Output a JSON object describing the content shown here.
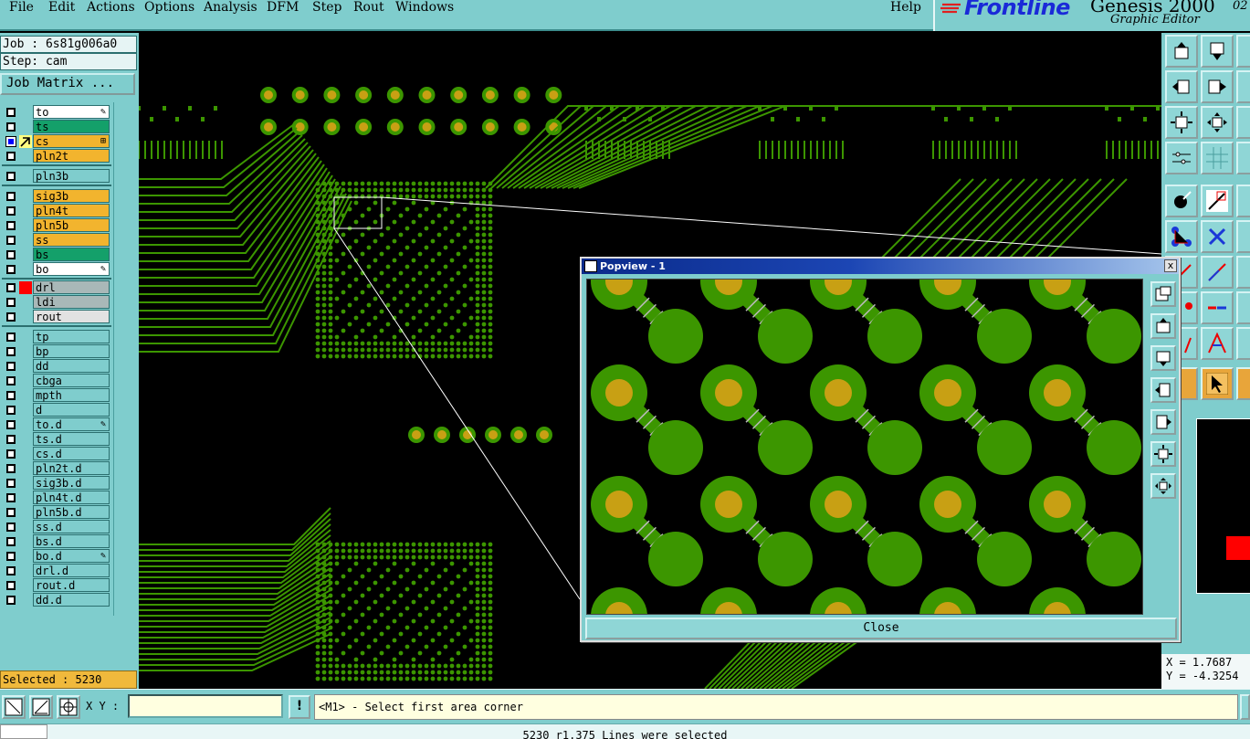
{
  "menu": {
    "items": [
      "File",
      "Edit",
      "Actions",
      "Options",
      "Analysis",
      "DFM",
      "Step",
      "Rout",
      "Windows"
    ],
    "help": "Help"
  },
  "brand": {
    "logo": "Frontline",
    "product": "Genesis 2000",
    "subtitle": "Graphic Editor",
    "version": "02"
  },
  "job": {
    "job_label": "Job : 6s81g006a0",
    "step_label": "Step: cam",
    "matrix_button": "Job Matrix ..."
  },
  "layers": [
    {
      "name": "to",
      "color": "#ffffff",
      "mark": "edit-icon"
    },
    {
      "name": "ts",
      "color": "#14a06a",
      "mark": ""
    },
    {
      "name": "cs",
      "color": "#f2b42e",
      "mark": "grid-icon",
      "selected": true
    },
    {
      "name": "pln2t",
      "color": "#f2b42e",
      "mark": ""
    },
    {
      "name": "pln3b",
      "color": "#7fcdcd",
      "mark": ""
    },
    {
      "name": "sig3b",
      "color": "#f2b42e",
      "mark": ""
    },
    {
      "name": "pln4t",
      "color": "#f2b42e",
      "mark": ""
    },
    {
      "name": "pln5b",
      "color": "#f2b42e",
      "mark": ""
    },
    {
      "name": "ss",
      "color": "#f2b42e",
      "mark": ""
    },
    {
      "name": "bs",
      "color": "#14a06a",
      "mark": ""
    },
    {
      "name": "bo",
      "color": "#ffffff",
      "mark": "edit-icon"
    },
    {
      "name": "drl",
      "color": "#a9b8b8",
      "mark": ""
    },
    {
      "name": "ldi",
      "color": "#a9b8b8",
      "mark": ""
    },
    {
      "name": "rout",
      "color": "#e2e2e2",
      "mark": ""
    },
    {
      "name": "tp",
      "color": "#7fcdcd",
      "mark": ""
    },
    {
      "name": "bp",
      "color": "#7fcdcd",
      "mark": ""
    },
    {
      "name": "dd",
      "color": "#7fcdcd",
      "mark": ""
    },
    {
      "name": "cbga",
      "color": "#7fcdcd",
      "mark": ""
    },
    {
      "name": "mpth",
      "color": "#7fcdcd",
      "mark": ""
    },
    {
      "name": "d",
      "color": "#7fcdcd",
      "mark": ""
    },
    {
      "name": "to.d",
      "color": "#7fcdcd",
      "mark": "edit-icon"
    },
    {
      "name": "ts.d",
      "color": "#7fcdcd",
      "mark": ""
    },
    {
      "name": "cs.d",
      "color": "#7fcdcd",
      "mark": ""
    },
    {
      "name": "pln2t.d",
      "color": "#7fcdcd",
      "mark": ""
    },
    {
      "name": "sig3b.d",
      "color": "#7fcdcd",
      "mark": ""
    },
    {
      "name": "pln4t.d",
      "color": "#7fcdcd",
      "mark": ""
    },
    {
      "name": "pln5b.d",
      "color": "#7fcdcd",
      "mark": ""
    },
    {
      "name": "ss.d",
      "color": "#7fcdcd",
      "mark": ""
    },
    {
      "name": "bs.d",
      "color": "#7fcdcd",
      "mark": ""
    },
    {
      "name": "bo.d",
      "color": "#7fcdcd",
      "mark": "edit-icon"
    },
    {
      "name": "drl.d",
      "color": "#7fcdcd",
      "mark": ""
    },
    {
      "name": "rout.d",
      "color": "#7fcdcd",
      "mark": ""
    },
    {
      "name": "dd.d",
      "color": "#7fcdcd",
      "mark": ""
    }
  ],
  "selected_count": "Selected : 5230",
  "popview": {
    "title": "Popview - 1",
    "close_label": "Close",
    "close_x": "x"
  },
  "coords": {
    "x": "X = 1.7687",
    "y": "Y = -4.3254"
  },
  "command": {
    "xy_label": "X Y :",
    "xy_value": "",
    "bang": "!",
    "prompt": "<M1> - Select first area corner"
  },
  "status": "5230 r1.375 Lines were selected",
  "colors": {
    "panel": "#7fcdcd",
    "copper": "#3c9600",
    "pad": "#c8a014",
    "selection": "#f2b42e"
  }
}
